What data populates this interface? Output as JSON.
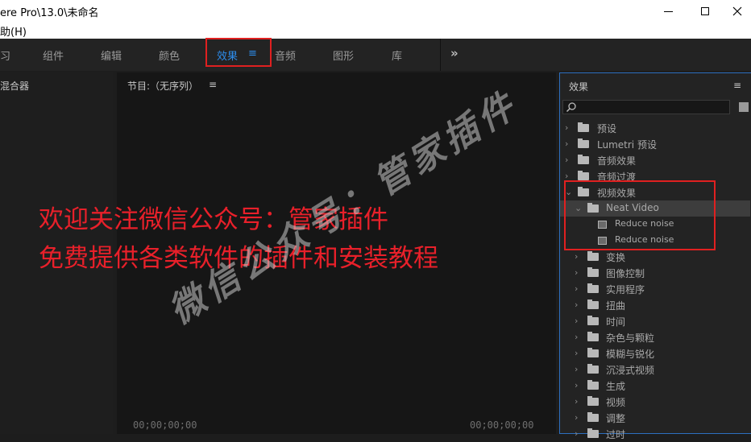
{
  "window": {
    "title": "ere Pro\\13.0\\未命名",
    "min_icon": "minimize-icon",
    "max_icon": "maximize-icon",
    "close_icon": "close-icon"
  },
  "menubar": {
    "help": "助(H)"
  },
  "workspace_tabs": [
    "习",
    "组件",
    "编辑",
    "颜色",
    "效果",
    "音频",
    "图形",
    "库"
  ],
  "workspace_active": "效果",
  "workspace_menu_glyph": "≡",
  "workspace_more": "»",
  "panels": {
    "left_title": "混合器",
    "program_title": "节目:（无序列）",
    "program_menu": "≡",
    "timecode_left": "00;00;00;00",
    "timecode_right": "00;00;00;00",
    "effects_title": "效果",
    "effects_menu": "≡"
  },
  "effects_tree": [
    "预设",
    "Lumetri 预设",
    "音频效果",
    "音频过渡",
    "视频效果",
    "Neat Video",
    "Reduce noise",
    "Reduce noise",
    "变换",
    "图像控制",
    "实用程序",
    "扭曲",
    "时间",
    "杂色与颗粒",
    "模糊与锐化",
    "沉浸式视频",
    "生成",
    "视频",
    "调整",
    "过时"
  ],
  "overlay_text": {
    "line1": "欢迎关注微信公众号：管家插件",
    "line2": "免费提供各类软件的插件和安装教程"
  },
  "watermark": "微信公众号：管家插件",
  "colors": {
    "accent_blue": "#2d8ceb",
    "highlight_red": "#e02020",
    "overlay_red": "#e8202a"
  }
}
